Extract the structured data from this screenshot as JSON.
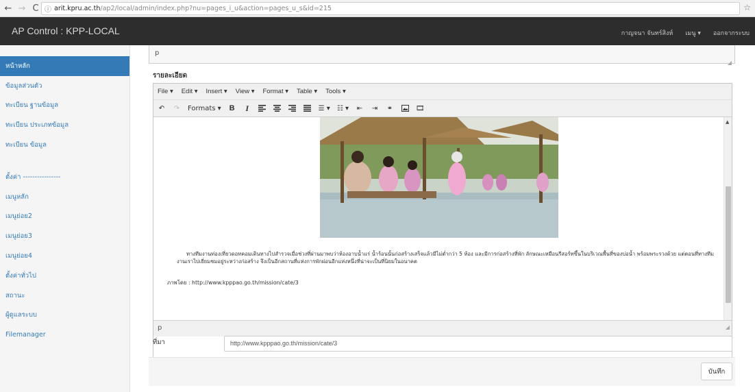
{
  "browser": {
    "back": "←",
    "forward": "→",
    "reload": "C",
    "info_icon": "ⓘ",
    "url_host": "arit.kpru.ac.th",
    "url_path": "/ap2/local/admin/index.php?nu=pages_i_u&action=pages_u_s&id=215",
    "star": "☆"
  },
  "navbar": {
    "brand": "AP Control : KPP-LOCAL",
    "user": "กาญจนา จันทร์สิงห์",
    "menu": "เมนู ▾",
    "logout": "ออกจากระบบ"
  },
  "sidebar": {
    "items": [
      {
        "label": "หน้าหลัก",
        "active": true
      },
      {
        "label": "ข้อมูลส่วนตัว"
      },
      {
        "label": "ทะเบียน ฐานข้อมูล"
      },
      {
        "label": "ทะเบียน ประเภทข้อมูล"
      },
      {
        "label": "ทะเบียน ข้อมูล"
      }
    ],
    "settings": [
      {
        "label": "ตั้งค่า ----------------"
      },
      {
        "label": "เมนูหลัก"
      },
      {
        "label": "เมนูย่อย2"
      },
      {
        "label": "เมนูย่อย3"
      },
      {
        "label": "เมนูย่อย4"
      },
      {
        "label": "ตั้งค่าทั่วไป"
      },
      {
        "label": "สถานะ"
      },
      {
        "label": "ผู้ดูแลระบบ"
      },
      {
        "label": "Filemanager"
      }
    ]
  },
  "main": {
    "top_field_path": "p",
    "section_label": "รายละเอียด",
    "editor": {
      "menus": [
        "File ▾",
        "Edit ▾",
        "Insert ▾",
        "View ▾",
        "Format ▾",
        "Table ▾",
        "Tools ▾"
      ],
      "formats_label": "Formats ▾",
      "paragraph": "ทางทีมงานท่องเที่ยวดอทคอมเดินทางไปสำรวจเมื่อช่วงที่ผ่านมาพบว่าห้องอาบน้ำแร่ น้ำร้อนนั้นก่อสร้างเสร็จแล้วมีไม่ต่ำกว่า 5 ห้อง และมีการก่อสร้างที่พัก ลักษณะเหมือนรีสอร์ทขึ้นในบริเวณพื้นที่ของบ่อน้ำ พร้อมพระรวงด้วย แต่ตอนที่ทางทีมงานเราไปเยี่ยมชมอยู่ระหว่างก่อสร้าง จึงเป็นอีกสถานที่แห่งการพักผ่อนอีกแห่งหนึ่งที่น่าจะเป็นที่นิยมในอนาคต",
      "credit": "ภาพโดย : http://www.kpppao.go.th/mission/cate/3",
      "status_path": "p"
    },
    "source_label": "ที่มา",
    "source_value": "http://www.kpppao.go.th/mission/cate/3",
    "save_label": "บันทึก"
  }
}
